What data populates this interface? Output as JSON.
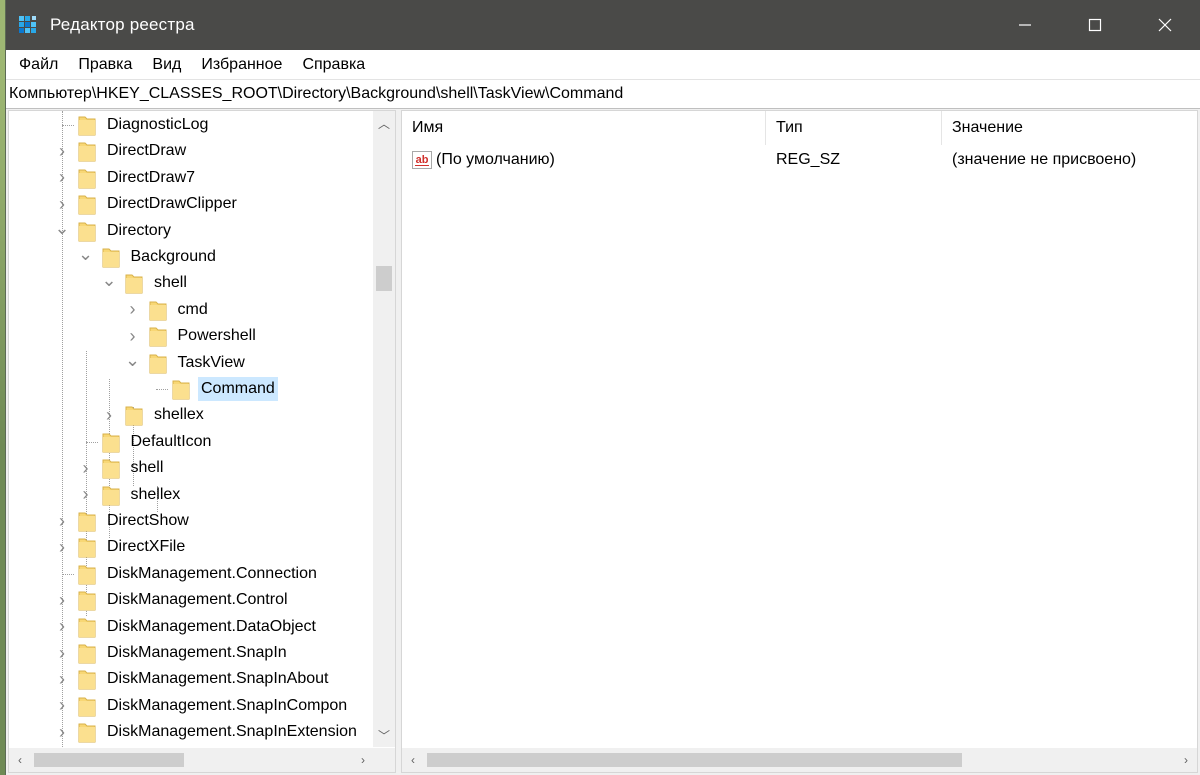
{
  "window": {
    "title": "Редактор реестра",
    "minimize_glyph": "—",
    "maximize_glyph": "☐",
    "close_glyph": "✕"
  },
  "menu": [
    "Файл",
    "Правка",
    "Вид",
    "Избранное",
    "Справка"
  ],
  "address": "Компьютер\\HKEY_CLASSES_ROOT\\Directory\\Background\\shell\\TaskView\\Command",
  "tree": [
    {
      "label": "DiagnosticLog",
      "expander": "none"
    },
    {
      "label": "DirectDraw",
      "expander": "collapsed"
    },
    {
      "label": "DirectDraw7",
      "expander": "collapsed"
    },
    {
      "label": "DirectDrawClipper",
      "expander": "collapsed"
    },
    {
      "label": "Directory",
      "expander": "expanded"
    },
    {
      "label": "Background",
      "expander": "expanded"
    },
    {
      "label": "shell",
      "expander": "expanded"
    },
    {
      "label": "cmd",
      "expander": "collapsed"
    },
    {
      "label": "Powershell",
      "expander": "collapsed"
    },
    {
      "label": "TaskView",
      "expander": "expanded"
    },
    {
      "label": "Command",
      "expander": "none",
      "selected": true
    },
    {
      "label": "shellex",
      "expander": "collapsed"
    },
    {
      "label": "DefaultIcon",
      "expander": "none"
    },
    {
      "label": "shell",
      "expander": "collapsed"
    },
    {
      "label": "shellex",
      "expander": "collapsed"
    },
    {
      "label": "DirectShow",
      "expander": "collapsed"
    },
    {
      "label": "DirectXFile",
      "expander": "collapsed"
    },
    {
      "label": "DiskManagement.Connection",
      "expander": "none"
    },
    {
      "label": "DiskManagement.Control",
      "expander": "collapsed"
    },
    {
      "label": "DiskManagement.DataObject",
      "expander": "collapsed"
    },
    {
      "label": "DiskManagement.SnapIn",
      "expander": "collapsed"
    },
    {
      "label": "DiskManagement.SnapInAbout",
      "expander": "collapsed"
    },
    {
      "label": "DiskManagement.SnapInCompon",
      "expander": "collapsed"
    },
    {
      "label": "DiskManagement.SnapInExtension",
      "expander": "collapsed"
    }
  ],
  "list": {
    "headers": {
      "name": "Имя",
      "type": "Тип",
      "value": "Значение"
    },
    "rows": [
      {
        "icon": "string-value-icon",
        "icon_text": "ab",
        "name": "(По умолчанию)",
        "type": "REG_SZ",
        "value": "(значение не присвоено)"
      }
    ]
  },
  "colors": {
    "titlebar": "#4a4a48",
    "selection": "#cce8ff",
    "folder": "#f8d775"
  }
}
